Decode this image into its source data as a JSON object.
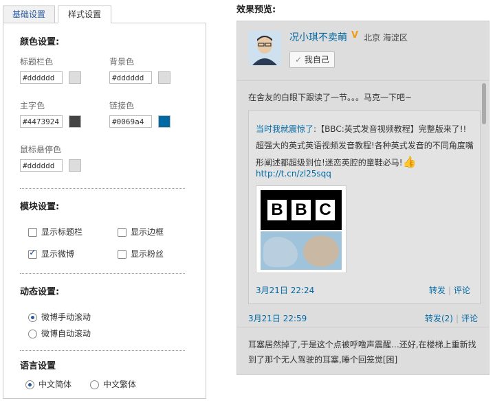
{
  "tabs": [
    "基础设置",
    "样式设置"
  ],
  "color_section": {
    "title": "颜色设置:",
    "fields": [
      {
        "label": "标题栏色",
        "value": "#dddddd",
        "swatch": "#dddddd"
      },
      {
        "label": "背景色",
        "value": "#dddddd",
        "swatch": "#dddddd"
      },
      {
        "label": "主字色",
        "value": "#4473924",
        "swatch": "#444444"
      },
      {
        "label": "链接色",
        "value": "#0069a4",
        "swatch": "#0069a4"
      },
      {
        "label": "鼠标悬停色",
        "value": "#dddddd",
        "swatch": "#dddddd"
      }
    ]
  },
  "module_section": {
    "title": "模块设置:",
    "options": [
      {
        "label": "显示标题栏",
        "checked": false
      },
      {
        "label": "显示边框",
        "checked": false
      },
      {
        "label": "显示微博",
        "checked": true
      },
      {
        "label": "显示粉丝",
        "checked": false
      }
    ]
  },
  "dynamic_section": {
    "title": "动态设置:",
    "options": [
      {
        "label": "微博手动滚动",
        "selected": true
      },
      {
        "label": "微博自动滚动",
        "selected": false
      }
    ]
  },
  "language_section": {
    "title": "语言设置",
    "options": [
      {
        "label": "中文简体",
        "selected": true
      },
      {
        "label": "中文繁体",
        "selected": false
      }
    ]
  },
  "preview": {
    "title": "效果预览:",
    "user": {
      "name": "况小琪不卖萌",
      "location": "北京 海淀区",
      "self_button": "我自己"
    },
    "post_text": "在舍友的白眼下跟读了一节。。。马克一下吧~",
    "quote": {
      "author": "当时我就震惊了",
      "colon": ":",
      "text": "【BBC:英式发音视频教程】完整版来了!!超强大的英式英语视频发音教程!各种英式发音的不同角度嘴形阐述都超级到位!迷恋英腔的童鞋必马!",
      "link": "http://t.cn/zl25sqq",
      "date": "3月21日 22:24",
      "repost": "转发",
      "comment": "评论",
      "bbc_letters": [
        "B",
        "B",
        "C"
      ]
    },
    "main_date": "3月21日 22:59",
    "main_repost": "转发(2)",
    "main_comment": "评论",
    "post2_text": "耳塞居然掉了,于是这个点被呼噜声震醒…还好,在楼梯上重新找到了那个无人驾驶的耳塞,睡个回笼觉[困]"
  }
}
